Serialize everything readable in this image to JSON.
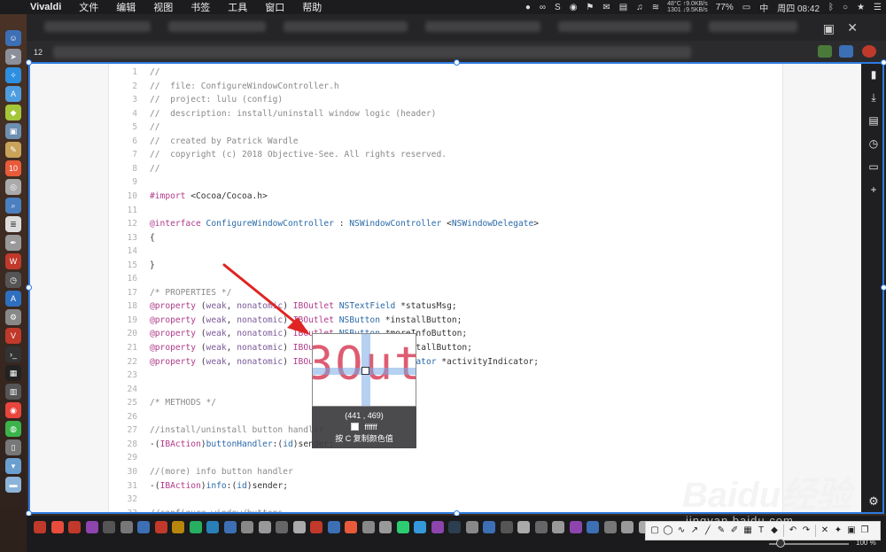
{
  "menubar": {
    "app": "Vivaldi",
    "menus": [
      "文件",
      "编辑",
      "视图",
      "书签",
      "工具",
      "窗口",
      "帮助"
    ],
    "status": {
      "temp": "48°C",
      "upload": "↑9.0KB/s",
      "rpm": "1301",
      "download": "↓9.5KB/s",
      "battery": "77%",
      "input_method": "中",
      "clock": "周四 08:42"
    }
  },
  "browser": {
    "zoom_indicator": "12"
  },
  "code": {
    "lines": [
      {
        "n": "1",
        "parts": [
          [
            "c-com",
            "//"
          ]
        ]
      },
      {
        "n": "2",
        "parts": [
          [
            "c-com",
            "//  file: ConfigureWindowController.h"
          ]
        ]
      },
      {
        "n": "3",
        "parts": [
          [
            "c-com",
            "//  project: lulu (config)"
          ]
        ]
      },
      {
        "n": "4",
        "parts": [
          [
            "c-com",
            "//  description: install/uninstall window logic (header)"
          ]
        ]
      },
      {
        "n": "5",
        "parts": [
          [
            "c-com",
            "//"
          ]
        ]
      },
      {
        "n": "6",
        "parts": [
          [
            "c-com",
            "//  created by Patrick Wardle"
          ]
        ]
      },
      {
        "n": "7",
        "parts": [
          [
            "c-com",
            "//  copyright (c) 2018 Objective-See. All rights reserved."
          ]
        ]
      },
      {
        "n": "8",
        "parts": [
          [
            "c-com",
            "//"
          ]
        ]
      },
      {
        "n": "9",
        "parts": []
      },
      {
        "n": "10",
        "parts": [
          [
            "c-dir",
            "#import"
          ],
          [
            "c-plain",
            " <Cocoa/Cocoa.h>"
          ]
        ]
      },
      {
        "n": "11",
        "parts": []
      },
      {
        "n": "12",
        "parts": [
          [
            "c-key",
            "@interface"
          ],
          [
            "c-type",
            " ConfigureWindowController"
          ],
          [
            "c-plain",
            " : "
          ],
          [
            "c-type",
            "NSWindowController"
          ],
          [
            "c-plain",
            " <"
          ],
          [
            "c-type",
            "NSWindowDelegate"
          ],
          [
            "c-plain",
            ">"
          ]
        ]
      },
      {
        "n": "13",
        "parts": [
          [
            "c-plain",
            "{"
          ]
        ]
      },
      {
        "n": "14",
        "parts": []
      },
      {
        "n": "15",
        "parts": [
          [
            "c-plain",
            "}"
          ]
        ]
      },
      {
        "n": "16",
        "parts": []
      },
      {
        "n": "17",
        "parts": [
          [
            "c-com",
            "/* PROPERTIES */"
          ]
        ]
      },
      {
        "n": "18",
        "parts": [
          [
            "c-key",
            "@property"
          ],
          [
            "c-plain",
            " ("
          ],
          [
            "c-attr",
            "weak"
          ],
          [
            "c-plain",
            ", "
          ],
          [
            "c-attr",
            "nonatomic"
          ],
          [
            "c-plain",
            ") "
          ],
          [
            "c-key",
            "IBOutlet"
          ],
          [
            "c-plain",
            " "
          ],
          [
            "c-type",
            "NSTextField"
          ],
          [
            "c-plain",
            " *statusMsg;"
          ]
        ]
      },
      {
        "n": "19",
        "parts": [
          [
            "c-key",
            "@property"
          ],
          [
            "c-plain",
            " ("
          ],
          [
            "c-attr",
            "weak"
          ],
          [
            "c-plain",
            ", "
          ],
          [
            "c-attr",
            "nonatomic"
          ],
          [
            "c-plain",
            ") "
          ],
          [
            "c-key",
            "IBOutlet"
          ],
          [
            "c-plain",
            " "
          ],
          [
            "c-type",
            "NSButton"
          ],
          [
            "c-plain",
            " *installButton;"
          ]
        ]
      },
      {
        "n": "20",
        "parts": [
          [
            "c-key",
            "@property"
          ],
          [
            "c-plain",
            " ("
          ],
          [
            "c-attr",
            "weak"
          ],
          [
            "c-plain",
            ", "
          ],
          [
            "c-attr",
            "nonatomic"
          ],
          [
            "c-plain",
            ") "
          ],
          [
            "c-key",
            "IBOutlet"
          ],
          [
            "c-plain",
            " "
          ],
          [
            "c-type",
            "NSButton"
          ],
          [
            "c-plain",
            " *moreInfoButton;"
          ]
        ]
      },
      {
        "n": "21",
        "parts": [
          [
            "c-key",
            "@property"
          ],
          [
            "c-plain",
            " ("
          ],
          [
            "c-attr",
            "weak"
          ],
          [
            "c-plain",
            ", "
          ],
          [
            "c-attr",
            "nonatomic"
          ],
          [
            "c-plain",
            ") "
          ],
          [
            "c-key",
            "IBOutlet"
          ],
          [
            "c-plain",
            " "
          ],
          [
            "c-type",
            "NSButton"
          ],
          [
            "c-plain",
            " *uninstallButton;"
          ]
        ]
      },
      {
        "n": "22",
        "parts": [
          [
            "c-key",
            "@property"
          ],
          [
            "c-plain",
            " ("
          ],
          [
            "c-attr",
            "weak"
          ],
          [
            "c-plain",
            ", "
          ],
          [
            "c-attr",
            "nonatomic"
          ],
          [
            "c-plain",
            ") "
          ],
          [
            "c-key",
            "IBOutlet"
          ],
          [
            "c-plain",
            " "
          ],
          [
            "c-type",
            "NSProgressIndicator"
          ],
          [
            "c-plain",
            " *activityIndicator;"
          ]
        ]
      },
      {
        "n": "23",
        "parts": []
      },
      {
        "n": "24",
        "parts": []
      },
      {
        "n": "25",
        "parts": [
          [
            "c-com",
            "/* METHODS */"
          ]
        ]
      },
      {
        "n": "26",
        "parts": []
      },
      {
        "n": "27",
        "parts": [
          [
            "c-com",
            "//install/uninstall button handler"
          ]
        ]
      },
      {
        "n": "28",
        "parts": [
          [
            "c-plain",
            "-("
          ],
          [
            "c-key",
            "IBAction"
          ],
          [
            "c-plain",
            ")"
          ],
          [
            "c-type",
            "buttonHandler"
          ],
          [
            "c-plain",
            ":("
          ],
          [
            "c-type",
            "id"
          ],
          [
            "c-plain",
            ")sender;"
          ]
        ]
      },
      {
        "n": "29",
        "parts": []
      },
      {
        "n": "30",
        "parts": [
          [
            "c-com",
            "//(more) info button handler"
          ]
        ]
      },
      {
        "n": "31",
        "parts": [
          [
            "c-plain",
            "-("
          ],
          [
            "c-key",
            "IBAction"
          ],
          [
            "c-plain",
            ")"
          ],
          [
            "c-type",
            "info"
          ],
          [
            "c-plain",
            ":("
          ],
          [
            "c-type",
            "id"
          ],
          [
            "c-plain",
            ")sender;"
          ]
        ]
      },
      {
        "n": "32",
        "parts": []
      },
      {
        "n": "33",
        "parts": [
          [
            "c-com",
            "//configure window/buttons"
          ]
        ]
      }
    ]
  },
  "magnifier": {
    "zoomed_text": "3Out",
    "coords": "(441  ,  469)",
    "color_hex": "ffffff",
    "hint": "按 C 复制颜色值"
  },
  "annotation_toolbar": {
    "zoom_percent": "100 %"
  },
  "watermark": {
    "brand": "Baidu经验",
    "url": "jingyan.baidu.com"
  }
}
